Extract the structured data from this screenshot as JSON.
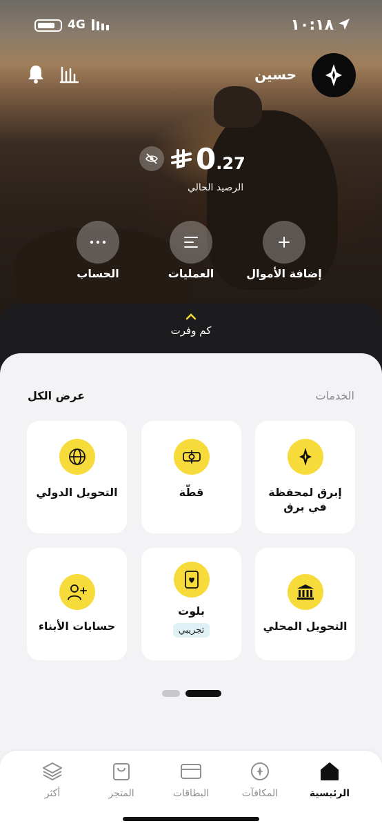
{
  "status_bar": {
    "time": "١٠:١٨",
    "network": "4G"
  },
  "header": {
    "user_name": "حسين"
  },
  "balance": {
    "integer": "0",
    "decimal": ".27",
    "label": "الرصيد الحالي"
  },
  "actions": [
    {
      "label": "إضافة الأموال"
    },
    {
      "label": "العمليات"
    },
    {
      "label": "الحساب"
    }
  ],
  "savings": {
    "label": "كم وفرت"
  },
  "services": {
    "title": "الخدمات",
    "view_all": "عرض الكل",
    "items": [
      {
        "label": "إبرق لمحفظة في برق",
        "icon": "barq-star-icon"
      },
      {
        "label": "قطّة",
        "icon": "split-icon"
      },
      {
        "label": "التحويل الدولي",
        "icon": "globe-icon"
      },
      {
        "label": "التحويل المحلي",
        "icon": "bank-icon"
      },
      {
        "label": "بلوت",
        "badge": "تجريبي",
        "icon": "playing-card-icon"
      },
      {
        "label": "حسابات الأبناء",
        "icon": "add-user-icon"
      }
    ]
  },
  "pagination": {
    "pages": 2,
    "current": 1
  },
  "tabs": [
    {
      "label": "الرئيسية",
      "active": true
    },
    {
      "label": "المكافآت",
      "active": false
    },
    {
      "label": "البطاقات",
      "active": false
    },
    {
      "label": "المتجر",
      "active": false
    },
    {
      "label": "أكثر",
      "active": false
    }
  ],
  "colors": {
    "accent": "#f7db3a",
    "dark": "#1c1c1e",
    "sheet": "#f3f3f6"
  }
}
